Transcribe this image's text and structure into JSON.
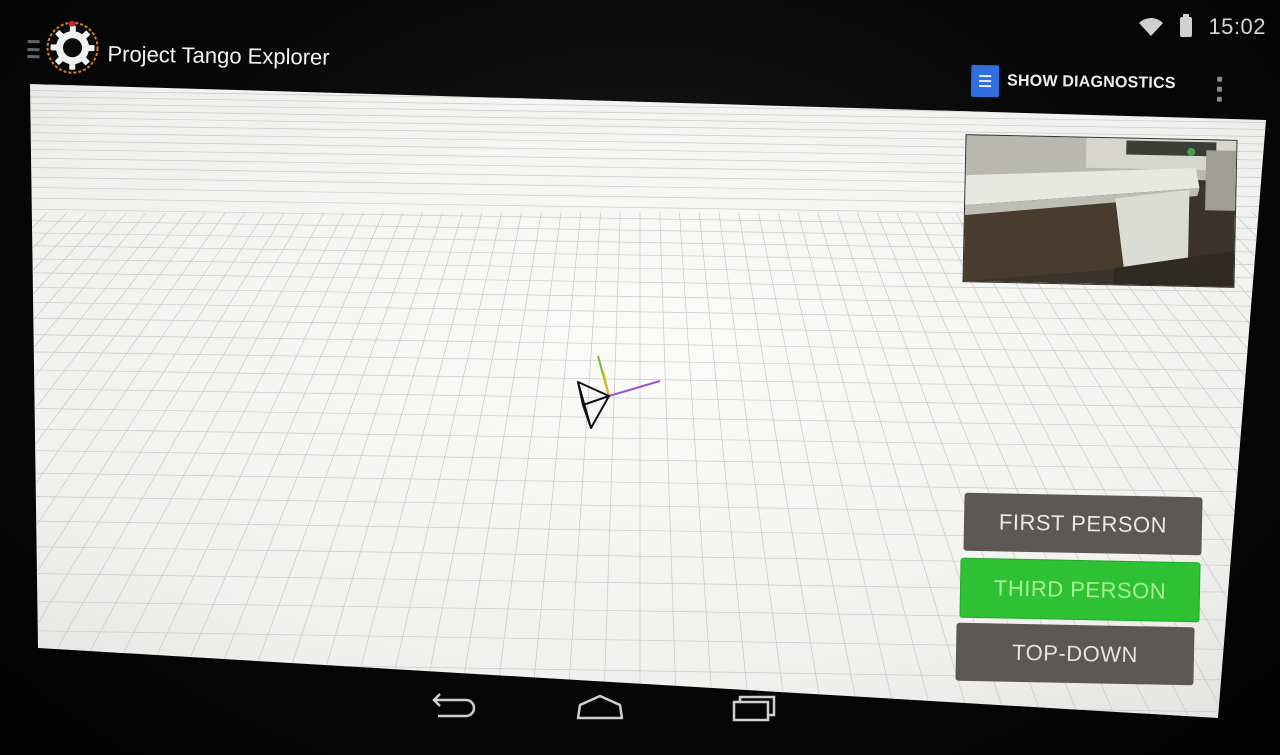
{
  "status_bar": {
    "time": "15:02",
    "icons": [
      "wifi-icon",
      "battery-icon"
    ]
  },
  "action_bar": {
    "app_icon": "gear-icon",
    "title": "Project Tango Explorer",
    "diagnostics_icon": "document-icon",
    "diagnostics_label": "SHOW DIAGNOSTICS",
    "overflow_icon": "overflow-menu-icon"
  },
  "viewport": {
    "description_icons": [
      "device-frustum-icon"
    ],
    "axis_colors": {
      "x": "#9a4fd6",
      "y": "#6fbf2a",
      "z": "#d8b81e"
    },
    "grid_color": "#c8c8c8",
    "background": "#f4f4f2"
  },
  "view_modes": {
    "first_person": "FIRST PERSON",
    "third_person": "THIRD PERSON",
    "top_down": "TOP-DOWN",
    "selected": "third_person",
    "active_color": "#2ec133",
    "inactive_color": "#5b5856"
  },
  "nav_bar": {
    "back_icon": "back-icon",
    "home_icon": "home-icon",
    "recents_icon": "recents-icon"
  }
}
